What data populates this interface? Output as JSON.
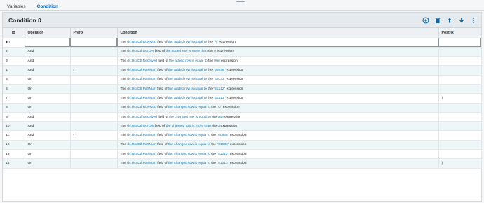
{
  "tabs": [
    {
      "label": "Variables"
    },
    {
      "label": "Condition"
    }
  ],
  "panel": {
    "title": "Condition 0"
  },
  "toolbar": {
    "icons": [
      "add-icon",
      "delete-icon",
      "move-up-icon",
      "move-down-icon",
      "more-icon"
    ]
  },
  "columns": {
    "id": "Id",
    "operator": "Operator",
    "prefix": "Prefix",
    "condition": "Condition",
    "postfix": "Postfix"
  },
  "rows": [
    {
      "id": "1",
      "operator": "",
      "prefix": "",
      "field": "ds.RcvDtl.RowMod",
      "compare": "the added row is equal to",
      "value": "\"A\"",
      "suffix": "expression",
      "postfix": ""
    },
    {
      "id": "2",
      "operator": "And",
      "prefix": "",
      "field": "ds.RcvDtl.OurQty",
      "compare": "the added row is more than",
      "value": "0",
      "suffix": "expression",
      "postfix": ""
    },
    {
      "id": "3",
      "operator": "And",
      "prefix": "",
      "field": "ds.RcvDtl.Received",
      "compare": "the added row is equal to",
      "value": "true",
      "suffix": "expression",
      "postfix": ""
    },
    {
      "id": "4",
      "operator": "And",
      "prefix": "(",
      "field": "ds.RcvDtl.PartNum",
      "compare": "the added row is equal to",
      "value": "\"60836\"",
      "suffix": "expression",
      "postfix": ""
    },
    {
      "id": "5",
      "operator": "Or",
      "prefix": "",
      "field": "ds.RcvDtl.PartNum",
      "compare": "the added row is equal to",
      "value": "\"61033\"",
      "suffix": "expression",
      "postfix": ""
    },
    {
      "id": "6",
      "operator": "Or",
      "prefix": "",
      "field": "ds.RcvDtl.PartNum",
      "compare": "the added row is equal to",
      "value": "\"51212\"",
      "suffix": "expression",
      "postfix": ""
    },
    {
      "id": "7",
      "operator": "Or",
      "prefix": "",
      "field": "ds.RcvDtl.PartNum",
      "compare": "the added row is equal to",
      "value": "\"51213\"",
      "suffix": "expression",
      "postfix": ")"
    },
    {
      "id": "8",
      "operator": "Or",
      "prefix": "",
      "field": "ds.RcvDtl.RowMod",
      "compare": "the changed row is equal to",
      "value": "\"U\"",
      "suffix": "expression",
      "postfix": ""
    },
    {
      "id": "9",
      "operator": "And",
      "prefix": "",
      "field": "ds.RcvDtl.Received",
      "compare": "the changed row is equal to",
      "value": "true",
      "suffix": "expression",
      "postfix": ""
    },
    {
      "id": "10",
      "operator": "And",
      "prefix": "",
      "field": "ds.RcvDtl.OurQty",
      "compare": "the changed row is more than",
      "value": "0",
      "suffix": "expression",
      "postfix": ""
    },
    {
      "id": "11",
      "operator": "And",
      "prefix": "(",
      "field": "ds.RcvDtl.PartNum",
      "compare": "the changed row is equal to",
      "value": "\"60836\"",
      "suffix": "expression",
      "postfix": ""
    },
    {
      "id": "12",
      "operator": "Or",
      "prefix": "",
      "field": "ds.RcvDtl.PartNum",
      "compare": "the changed row is equal to",
      "value": "\"61033\"",
      "suffix": "expression",
      "postfix": ""
    },
    {
      "id": "13",
      "operator": "Or",
      "prefix": "",
      "field": "ds.RcvDtl.PartNum",
      "compare": "the changed row is equal to",
      "value": "\"51212\"",
      "suffix": "expression",
      "postfix": ""
    },
    {
      "id": "14",
      "operator": "Or",
      "prefix": "",
      "field": "ds.RcvDtl.PartNum",
      "compare": "the changed row is equal to",
      "value": "\"51213\"",
      "suffix": "expression",
      "postfix": ")"
    }
  ],
  "condition_words": {
    "the": "The",
    "field_of": "field of",
    "the_word": "the"
  },
  "colors": {
    "accent": "#0a66a8",
    "link": "#1a7bb8",
    "alt_row": "#eef6f7",
    "header_bg": "#e4eaee"
  }
}
